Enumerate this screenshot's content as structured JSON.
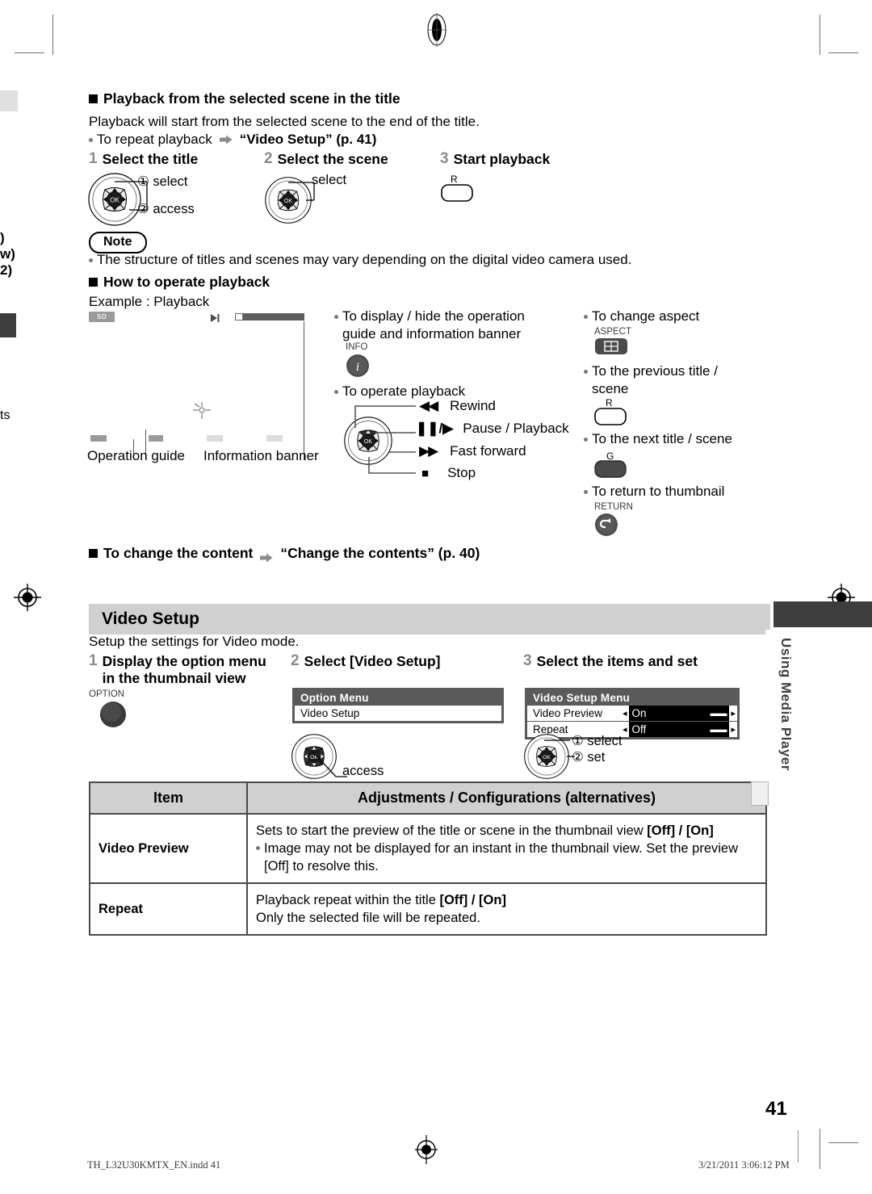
{
  "facing_page_bleed": {
    "lines": [
      ")",
      "w)",
      "2)"
    ],
    "lower_text": "ts"
  },
  "section1": {
    "heading": "Playback from the selected scene in the title",
    "intro": "Playback will start from the selected scene to the end of the title.",
    "bullet": "To repeat playback",
    "bullet_ref": "“Video Setup” (p. 41)",
    "steps": [
      {
        "num": "1",
        "label": "Select the title",
        "captions": [
          "① select",
          "② access"
        ]
      },
      {
        "num": "2",
        "label": "Select the scene",
        "captions": [
          "select"
        ]
      },
      {
        "num": "3",
        "label": "Start playback",
        "button_label": "R"
      }
    ]
  },
  "note": {
    "label": "Note",
    "text": "The structure of titles and scenes may vary depending on the digital video camera used."
  },
  "section2": {
    "heading": "How to operate playback",
    "example": "Example : Playback",
    "illustration": {
      "badge": "SD",
      "label_left": "Operation guide",
      "label_right": "Information banner"
    },
    "column_mid": [
      {
        "text": "To display / hide the operation guide and information banner",
        "button_name": "INFO",
        "icon": "info-icon"
      },
      {
        "text": "To operate playback",
        "functions": [
          {
            "icon": "rewind-icon",
            "glyph": "◀◀",
            "label": "Rewind"
          },
          {
            "icon": "pause-play-icon",
            "glyph": "Ⅱ/▶",
            "label": "Pause / Playback"
          },
          {
            "icon": "fast-forward-icon",
            "glyph": "▶▶",
            "label": "Fast forward"
          },
          {
            "icon": "stop-icon",
            "glyph": "■",
            "label": "Stop"
          }
        ]
      }
    ],
    "column_right": [
      {
        "text": "To change aspect",
        "button_name": "ASPECT",
        "icon": "aspect-icon"
      },
      {
        "text": "To the previous title / scene",
        "button_name": "R",
        "icon": "red-button-icon"
      },
      {
        "text": "To the next title / scene",
        "button_name": "G",
        "icon": "green-button-icon"
      },
      {
        "text": "To return to thumbnail",
        "button_name": "RETURN",
        "icon": "return-icon"
      }
    ]
  },
  "section3": {
    "heading": "To change the content",
    "ref": "“Change the contents” (p. 40)"
  },
  "video_setup": {
    "bar_title": "Video Setup",
    "intro": "Setup the settings for Video mode.",
    "steps": [
      {
        "num": "1",
        "label_line1": "Display the option menu",
        "label_line2": "in the thumbnail view",
        "button_name": "OPTION"
      },
      {
        "num": "2",
        "label": "Select [Video Setup]",
        "caption": "access"
      },
      {
        "num": "3",
        "label": "Select the items and set",
        "captions": [
          "① select",
          "② set"
        ]
      }
    ],
    "option_menu": {
      "title": "Option Menu",
      "items": [
        "Video Setup"
      ]
    },
    "setup_menu": {
      "title": "Video Setup Menu",
      "rows": [
        {
          "label": "Video Preview",
          "value": "On"
        },
        {
          "label": "Repeat",
          "value": "Off"
        }
      ]
    },
    "table": {
      "headers": [
        "Item",
        "Adjustments / Configurations (alternatives)"
      ],
      "rows": [
        {
          "item": "Video Preview",
          "main": "Sets to start the preview of the title or scene in the thumbnail view [Off] / [On]",
          "main_plain": "Sets to start the preview of the title or scene in the thumbnail view ",
          "main_bold": "[Off] / [On]",
          "bullets": [
            "Image may not be displayed for an instant in the thumbnail view. Set the preview [Off] to resolve this."
          ]
        },
        {
          "item": "Repeat",
          "main_plain": "Playback repeat within the title ",
          "main_bold": "[Off] / [On]",
          "extra": "Only the selected file will be repeated."
        }
      ]
    }
  },
  "side_tab": {
    "label": "Using Media Player"
  },
  "footer": {
    "file": "TH_L32U30KMTX_EN.indd   41",
    "timestamp": "3/21/2011   3:06:12 PM",
    "page_number": "41"
  },
  "colors": {
    "grey_bar": "#d0d0d0",
    "dark_tab": "#3d3d3d",
    "osd_frame": "#5a5a5a",
    "step_num": "#8c8c8c"
  }
}
